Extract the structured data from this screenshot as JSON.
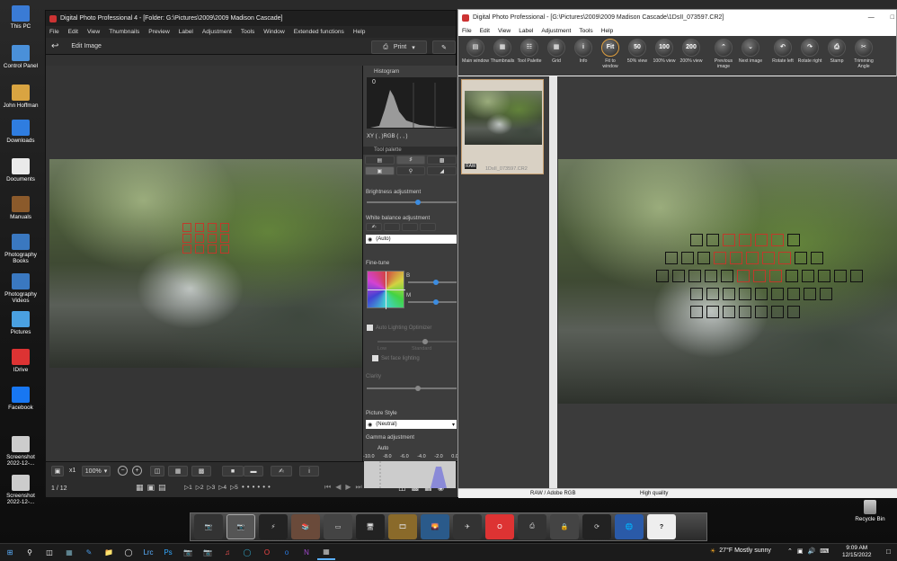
{
  "desktop": {
    "icons": [
      {
        "label": "This PC",
        "color": "#3a7bd5"
      },
      {
        "label": "Control Panel",
        "color": "#4a90d9"
      },
      {
        "label": "John Hoffman",
        "color": "#d9a441"
      },
      {
        "label": "Downloads",
        "color": "#2f7de0"
      },
      {
        "label": "Documents",
        "color": "#eaeaea"
      },
      {
        "label": "Manuals",
        "color": "#8b5a2b"
      },
      {
        "label": "Photography Books",
        "color": "#3a78c0"
      },
      {
        "label": "Photography Videos",
        "color": "#3a78c0"
      },
      {
        "label": "Pictures",
        "color": "#4aa0e0"
      },
      {
        "label": "IDrive",
        "color": "#d33"
      },
      {
        "label": "Facebook",
        "color": "#1877f2"
      },
      {
        "label": "Screenshot 2022-12-...",
        "color": "#ccc"
      },
      {
        "label": "Screenshot 2022-12-...",
        "color": "#ccc"
      }
    ],
    "recycle_bin": "Recycle Bin"
  },
  "main_window": {
    "title": "Digital Photo Professional 4 - [Folder: G:\\Pictures\\2009\\2009 Madison Cascade]",
    "menu": [
      "File",
      "Edit",
      "View",
      "Thumbnails",
      "Preview",
      "Label",
      "Adjustment",
      "Tools",
      "Window",
      "Extended functions",
      "Help"
    ],
    "edit_image_label": "Edit Image",
    "print_label": "Print",
    "zoom_label": "100%",
    "x1_label": "x1",
    "counter": "1 / 12",
    "histogram": {
      "title": "Histogram",
      "zero": "0",
      "readout": "XY (    ,    )RGB (    ,    ,    )"
    },
    "tool_palette": "Tool palette",
    "brightness": "Brightness adjustment",
    "white_balance": "White balance adjustment",
    "wb_value": "(Auto)",
    "fine_tune": "Fine-tune",
    "fine_tune_b": "B",
    "fine_tune_m": "M",
    "auto_lighting": "Auto Lighting Optimizer",
    "auto_lighting_levels": [
      "Low",
      "Standard"
    ],
    "face_lighting": "Set face lighting",
    "clarity": "Clarity",
    "picture_style": "Picture Style",
    "picture_style_value": "(Neutral)",
    "gamma": "Gamma adjustment",
    "gamma_auto": "Auto",
    "gamma_scale": [
      "-10.0",
      "-8.0",
      "-6.0",
      "-4.0",
      "-2.0",
      "0.0"
    ],
    "bottom_ratings": [
      "▷1",
      "▷2",
      "▷3",
      "▷4",
      "▷5"
    ]
  },
  "second_window": {
    "title": "Digital Photo Professional - [G:\\Pictures\\2009\\2009 Madison Cascade\\1DsII_073597.CR2]",
    "menu": [
      "File",
      "Edit",
      "View",
      "Label",
      "Adjustment",
      "Tools",
      "Help"
    ],
    "toolbar": [
      {
        "label": "Main window",
        "glyph": "▤"
      },
      {
        "label": "Thumbnails",
        "glyph": "▦"
      },
      {
        "label": "Tool Palette",
        "glyph": "☷"
      },
      {
        "label": "Grid",
        "glyph": "▦"
      },
      {
        "label": "Info",
        "glyph": "i"
      },
      {
        "label": "Fit to window",
        "glyph": "Fit"
      },
      {
        "label": "50% view",
        "glyph": "50"
      },
      {
        "label": "100% view",
        "glyph": "100"
      },
      {
        "label": "200% view",
        "glyph": "200"
      },
      {
        "label": "Previous image",
        "glyph": "⌃"
      },
      {
        "label": "Next image",
        "glyph": "⌄"
      },
      {
        "label": "Rotate left",
        "glyph": "↶"
      },
      {
        "label": "Rotate right",
        "glyph": "↷"
      },
      {
        "label": "Stamp",
        "glyph": "⎙"
      },
      {
        "label": "Trimming Angle",
        "glyph": "✂"
      }
    ],
    "thumb_name": "1DsII_073597.CR2",
    "raw_badge": "RAW",
    "status_color": "RAW / Adobe RGB",
    "status_quality": "High quality"
  },
  "taskbar": {
    "weather": "27°F  Mostly sunny",
    "time": "9:09 AM",
    "date": "12/15/2022"
  }
}
